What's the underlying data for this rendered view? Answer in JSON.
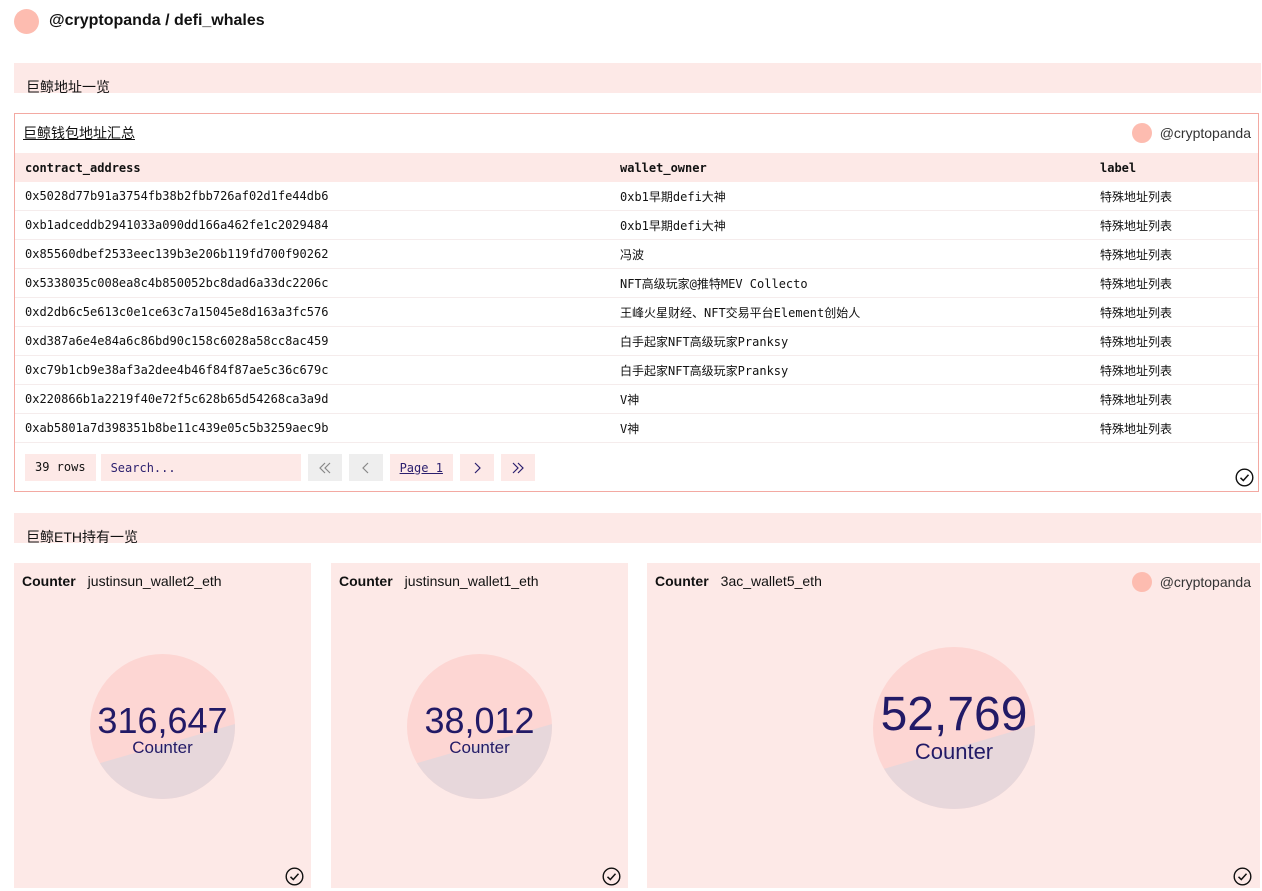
{
  "header": {
    "title": "@cryptopanda / defi_whales"
  },
  "sections": {
    "whale_addresses": "巨鲸地址一览",
    "eth_holdings": "巨鲸ETH持有一览"
  },
  "table_card": {
    "title": "巨鲸钱包地址汇总",
    "author": "@cryptopanda",
    "columns": [
      "contract_address",
      "wallet_owner",
      "label"
    ],
    "rows": [
      [
        "0x5028d77b91a3754fb38b2fbb726af02d1fe44db6",
        "0xb1早期defi大神",
        "特殊地址列表"
      ],
      [
        "0xb1adceddb2941033a090dd166a462fe1c2029484",
        "0xb1早期defi大神",
        "特殊地址列表"
      ],
      [
        "0x85560dbef2533eec139b3e206b119fd700f90262",
        "冯波",
        "特殊地址列表"
      ],
      [
        "0x5338035c008ea8c4b850052bc8dad6a33dc2206c",
        "NFT高级玩家@推特MEV Collecto",
        "特殊地址列表"
      ],
      [
        "0xd2db6c5e613c0e1ce63c7a15045e8d163a3fc576",
        "王峰火星财经、NFT交易平台Element创始人",
        "特殊地址列表"
      ],
      [
        "0xd387a6e4e84a6c86bd90c158c6028a58cc8ac459",
        "白手起家NFT高级玩家Pranksy",
        "特殊地址列表"
      ],
      [
        "0xc79b1cb9e38af3a2dee4b46f84f87ae5c36c679c",
        "白手起家NFT高级玩家Pranksy",
        "特殊地址列表"
      ],
      [
        "0x220866b1a2219f40e72f5c628b65d54268ca3a9d",
        "V神",
        "特殊地址列表"
      ],
      [
        "0xab5801a7d398351b8be11c439e05c5b3259aec9b",
        "V神",
        "特殊地址列表"
      ]
    ],
    "rows_count": "39 rows",
    "search_placeholder": "Search...",
    "page_label": "Page 1"
  },
  "counters": [
    {
      "type_label": "Counter",
      "name": "justinsun_wallet2_eth",
      "value": "316,647",
      "caption": "Counter"
    },
    {
      "type_label": "Counter",
      "name": "justinsun_wallet1_eth",
      "value": "38,012",
      "caption": "Counter"
    },
    {
      "type_label": "Counter",
      "name": "3ac_wallet5_eth",
      "value": "52,769",
      "caption": "Counter",
      "author": "@cryptopanda"
    }
  ],
  "colors": {
    "accent_bg": "#fde9e7",
    "avatar": "#fdbcb0",
    "number": "#221a66",
    "border": "#f3a9a2"
  }
}
